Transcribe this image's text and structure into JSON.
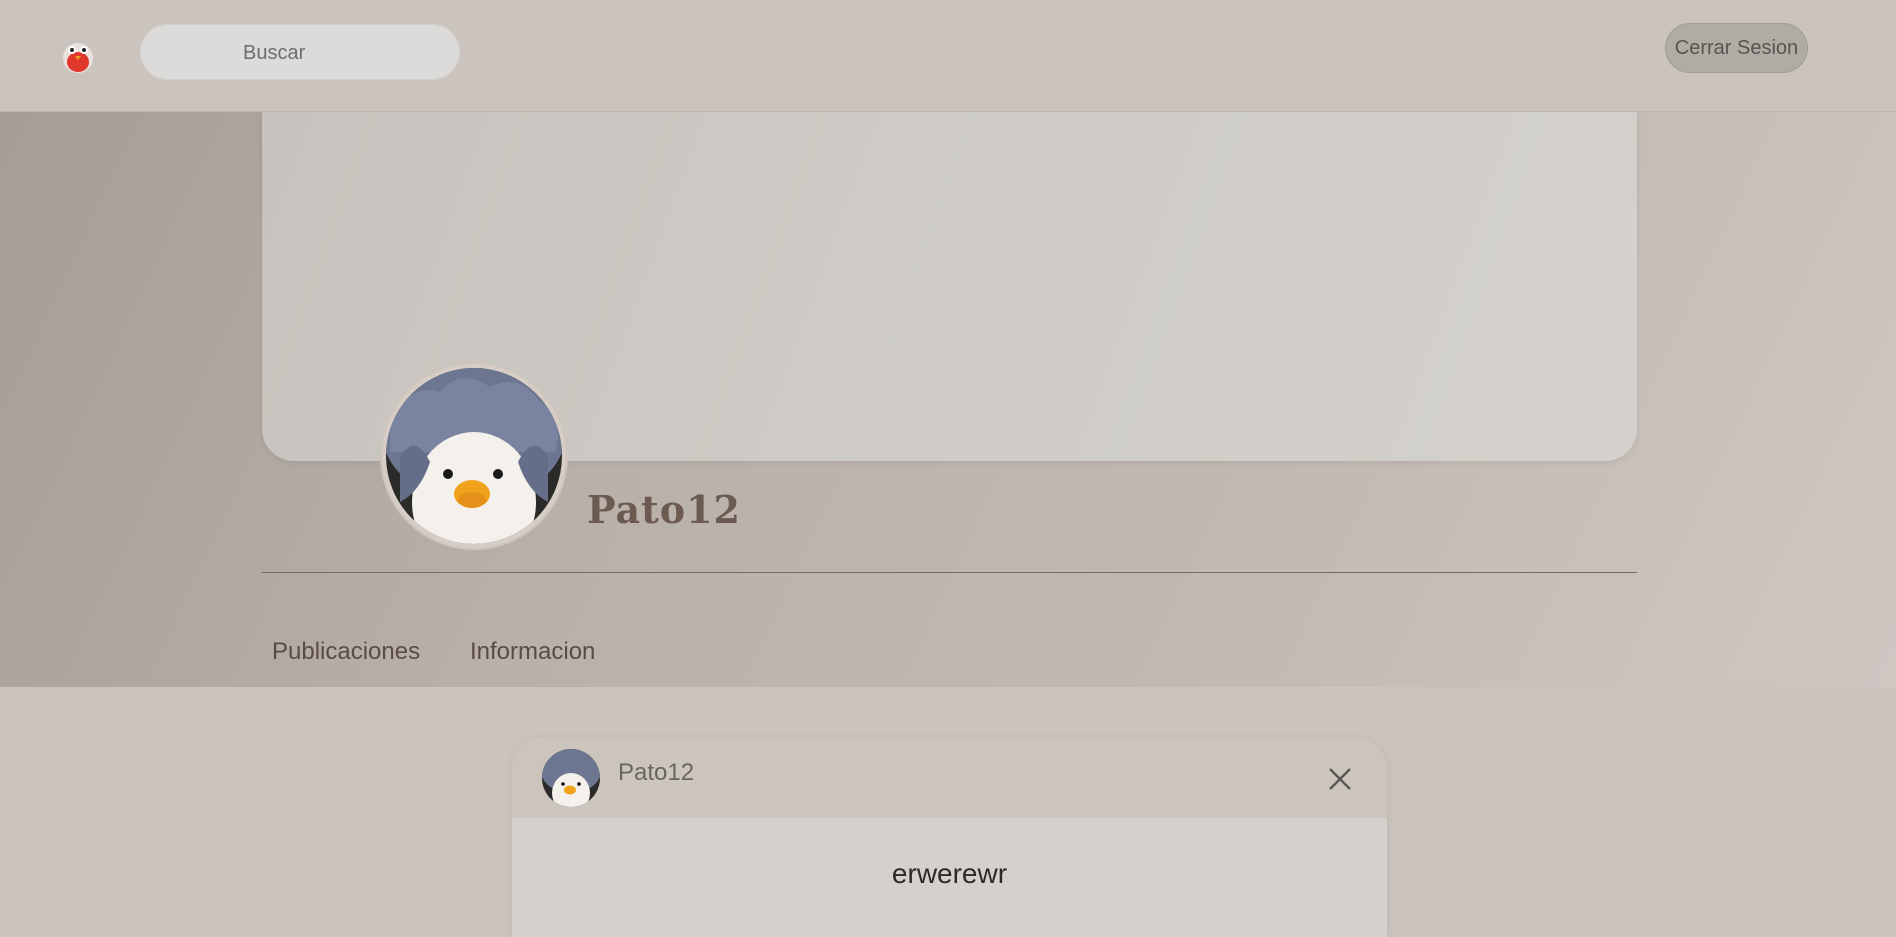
{
  "header": {
    "logo_icon": "bird-logo-icon",
    "search": {
      "placeholder": "Buscar",
      "value": ""
    },
    "logout_label": "Cerrar Sesion"
  },
  "profile": {
    "username": "Pato12",
    "avatar_icon": "duck-plush-avatar",
    "tabs": [
      {
        "label": "Publicaciones"
      },
      {
        "label": "Informacion"
      }
    ]
  },
  "post": {
    "author": "Pato12",
    "close_icon": "close-icon",
    "text": "erwerewr"
  },
  "colors": {
    "page_background": "#cbc3bd",
    "cover": "#cfccc7",
    "username": "#6b5a50",
    "divider": "#7a6a5c"
  }
}
